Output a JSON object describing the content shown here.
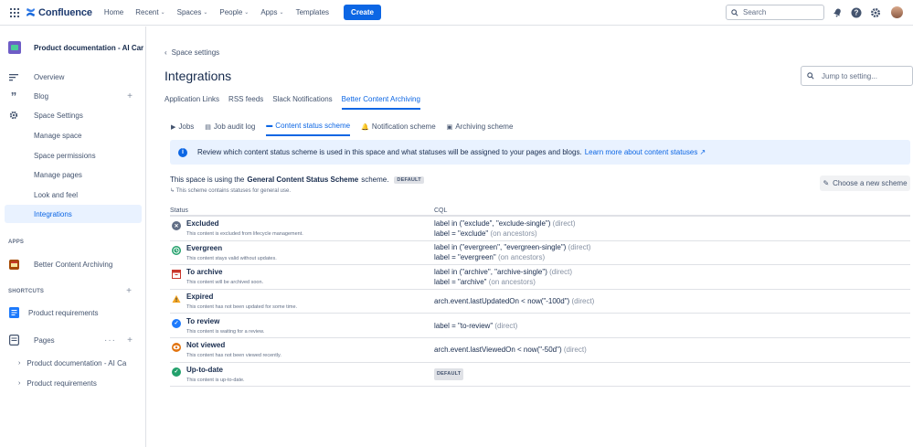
{
  "topnav": {
    "brand": "Confluence",
    "items": [
      {
        "label": "Home",
        "dropdown": false
      },
      {
        "label": "Recent",
        "dropdown": true
      },
      {
        "label": "Spaces",
        "dropdown": true
      },
      {
        "label": "People",
        "dropdown": true
      },
      {
        "label": "Apps",
        "dropdown": true
      },
      {
        "label": "Templates",
        "dropdown": false
      }
    ],
    "create_label": "Create",
    "search_placeholder": "Search",
    "colors": {
      "brand": "#0c66e4"
    }
  },
  "sidebar": {
    "space_name": "Product documentation - AI Car",
    "items": [
      {
        "label": "Overview",
        "icon": "overview-icon"
      },
      {
        "label": "Blog",
        "icon": "blog-icon"
      },
      {
        "label": "Space Settings",
        "icon": "gear-icon"
      },
      {
        "label": "Manage space"
      },
      {
        "label": "Space permissions"
      },
      {
        "label": "Manage pages"
      },
      {
        "label": "Look and feel"
      },
      {
        "label": "Integrations",
        "active": true
      }
    ],
    "apps_heading": "APPS",
    "apps": [
      {
        "label": "Better Content Archiving"
      }
    ],
    "shortcuts_heading": "SHORTCUTS",
    "shortcuts": [
      {
        "label": "Product requirements"
      }
    ],
    "pages_label": "Pages",
    "tree": [
      {
        "label": "Product documentation - AI Ca..."
      },
      {
        "label": "Product requirements"
      }
    ]
  },
  "main": {
    "back_label": "Space settings",
    "title": "Integrations",
    "jump_placeholder": "Jump to setting...",
    "tabs": [
      {
        "label": "Application Links"
      },
      {
        "label": "RSS feeds"
      },
      {
        "label": "Slack Notifications"
      },
      {
        "label": "Better Content Archiving",
        "active": true
      }
    ],
    "subtabs": [
      {
        "label": "Jobs",
        "icon": "play-icon"
      },
      {
        "label": "Job audit log",
        "icon": "document-icon"
      },
      {
        "label": "Content status scheme",
        "icon": "card-icon",
        "active": true
      },
      {
        "label": "Notification scheme",
        "icon": "bell-icon"
      },
      {
        "label": "Archiving scheme",
        "icon": "archive-icon"
      }
    ],
    "banner": {
      "text": "Review which content status scheme is used in this space and what statuses will be assigned to your pages and blogs.",
      "link": "Learn more about content statuses ↗"
    },
    "scheme": {
      "prefix": "This space is using the",
      "name": "General Content Status Scheme",
      "suffix": "scheme.",
      "badge": "DEFAULT",
      "subtext": "↳ This scheme contains statuses for general use.",
      "choose_label": "Choose a new scheme"
    },
    "table": {
      "headers": {
        "status": "Status",
        "cql": "CQL"
      },
      "rows": [
        {
          "name": "Excluded",
          "desc": "This content is excluded from lifecycle management.",
          "icon": "excluded-icon",
          "color": "#626f86",
          "cql1": "label in (\"exclude\", \"exclude-single\")",
          "cql1_note": "(direct)",
          "cql2": "label = \"exclude\"",
          "cql2_note": "(on ancestors)"
        },
        {
          "name": "Evergreen",
          "desc": "This content stays valid without updates.",
          "icon": "clock-icon",
          "color": "#22a06b",
          "cql1": "label in (\"evergreen\", \"evergreen-single\")",
          "cql1_note": "(direct)",
          "cql2": "label = \"evergreen\"",
          "cql2_note": "(on ancestors)"
        },
        {
          "name": "To archive",
          "desc": "This content will be archived soon.",
          "icon": "archive-box-icon",
          "color": "#c9372c",
          "cql1": "label in (\"archive\", \"archive-single\")",
          "cql1_note": "(direct)",
          "cql2": "label = \"archive\"",
          "cql2_note": "(on ancestors)"
        },
        {
          "name": "Expired",
          "desc": "This content has not been updated for some time.",
          "icon": "warning-icon",
          "color": "#f5a623",
          "cql1": "arch.event.lastUpdatedOn < now(\"-100d\")",
          "cql1_note": "(direct)",
          "cql2": "",
          "cql2_note": ""
        },
        {
          "name": "To review",
          "desc": "This content is waiting for a review.",
          "icon": "check-circle-icon",
          "color": "#1d7afc",
          "cql1": "label = \"to-review\"",
          "cql1_note": "(direct)",
          "cql2": "",
          "cql2_note": ""
        },
        {
          "name": "Not viewed",
          "desc": "This content has not been viewed recently.",
          "icon": "eye-icon",
          "color": "#e2740f",
          "cql1": "arch.event.lastViewedOn < now(\"-50d\")",
          "cql1_note": "(direct)",
          "cql2": "",
          "cql2_note": ""
        },
        {
          "name": "Up-to-date",
          "desc": "This content is up-to-date.",
          "icon": "check-icon",
          "color": "#22a06b",
          "badge": "DEFAULT"
        }
      ]
    }
  }
}
